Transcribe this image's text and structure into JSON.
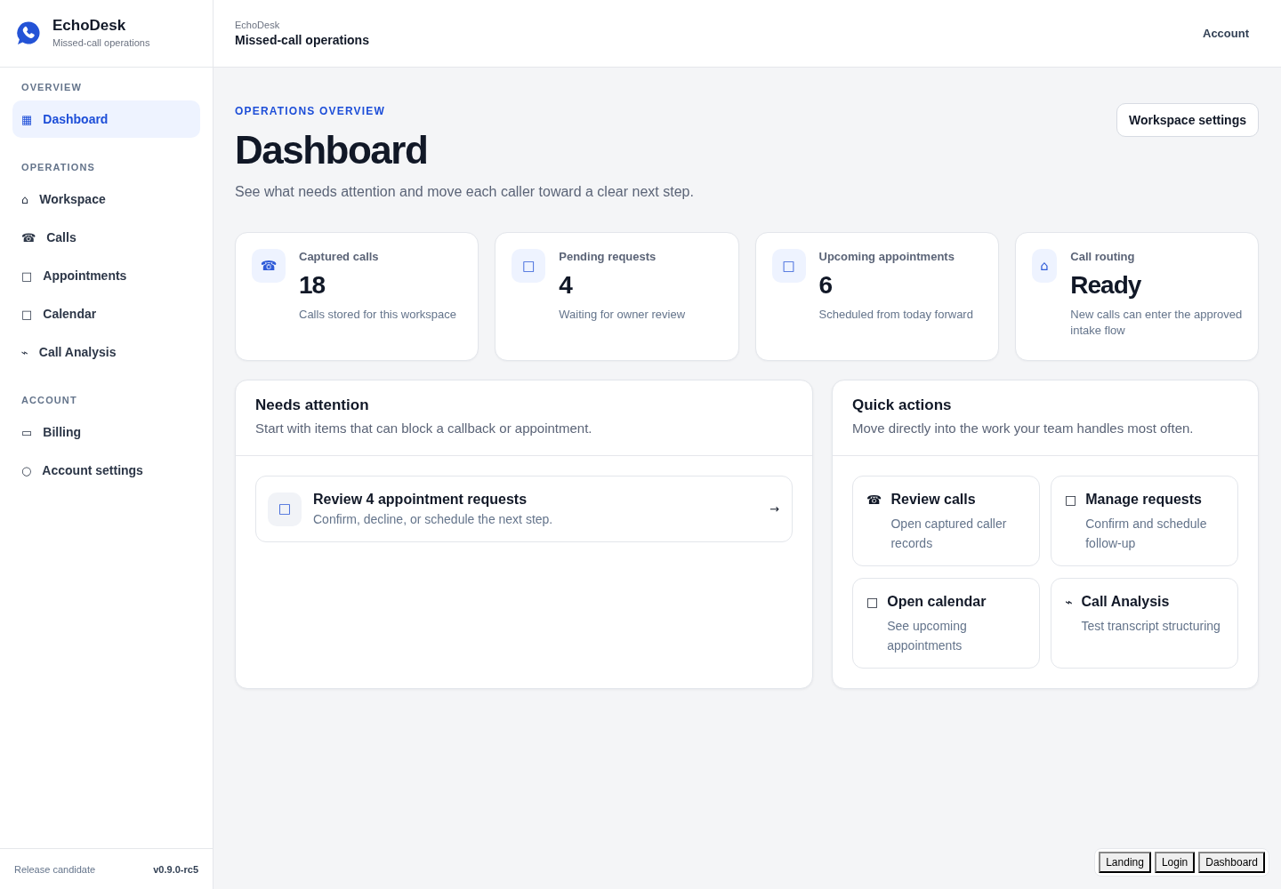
{
  "sidebar": {
    "brand": {
      "name": "EchoDesk",
      "tagline": "Missed-call operations"
    },
    "sections": [
      {
        "heading": "OVERVIEW",
        "items": [
          {
            "icon": "▦",
            "label": "Dashboard",
            "selected": true
          }
        ]
      },
      {
        "heading": "OPERATIONS",
        "items": [
          {
            "icon": "⌂",
            "label": "Workspace",
            "selected": false
          },
          {
            "icon": "☎",
            "label": "Calls",
            "selected": false
          },
          {
            "icon": "□",
            "label": "Appointments",
            "selected": false
          },
          {
            "icon": "□",
            "label": "Calendar",
            "selected": false
          },
          {
            "icon": "⌁",
            "label": "Call Analysis",
            "selected": false
          }
        ]
      },
      {
        "heading": "ACCOUNT",
        "items": [
          {
            "icon": "▭",
            "label": "Billing",
            "selected": false
          },
          {
            "icon": "○",
            "label": "Account settings",
            "selected": false
          }
        ]
      }
    ],
    "footer": {
      "label": "Release candidate",
      "version": "v0.9.0-rc5"
    }
  },
  "topbar": {
    "breadcrumb": "EchoDesk",
    "title": "Missed-call operations",
    "account": "Account"
  },
  "page_header": {
    "eyebrow": "OPERATIONS OVERVIEW",
    "title": "Dashboard",
    "subtitle": "See what needs attention and move each caller toward a clear next step.",
    "button": "Workspace settings"
  },
  "stats": [
    {
      "icon": "☎",
      "label": "Captured calls",
      "value": "18",
      "description": "Calls stored for this workspace"
    },
    {
      "icon": "□",
      "label": "Pending requests",
      "value": "4",
      "description": "Waiting for owner review"
    },
    {
      "icon": "□",
      "label": "Upcoming appointments",
      "value": "6",
      "description": "Scheduled from today forward"
    },
    {
      "icon": "⌂",
      "label": "Call routing",
      "value": "Ready",
      "description": "New calls can enter the approved intake flow"
    }
  ],
  "needs_attention": {
    "title": "Needs attention",
    "description": "Start with items that can block a callback or appointment.",
    "items": [
      {
        "icon": "□",
        "title": "Review 4 appointment requests",
        "description": "Confirm, decline, or schedule the next step.",
        "arrow": "→"
      }
    ]
  },
  "quick_actions": {
    "title": "Quick actions",
    "description": "Move directly into the work your team handles most often.",
    "items": [
      {
        "icon": "☎",
        "title": "Review calls",
        "description": "Open captured caller records"
      },
      {
        "icon": "□",
        "title": "Manage requests",
        "description": "Confirm and schedule follow-up"
      },
      {
        "icon": "□",
        "title": "Open calendar",
        "description": "See upcoming appointments"
      },
      {
        "icon": "⌁",
        "title": "Call Analysis",
        "description": "Test transcript structuring"
      }
    ]
  },
  "dev_nav": [
    "Landing",
    "Login",
    "Dashboard"
  ]
}
